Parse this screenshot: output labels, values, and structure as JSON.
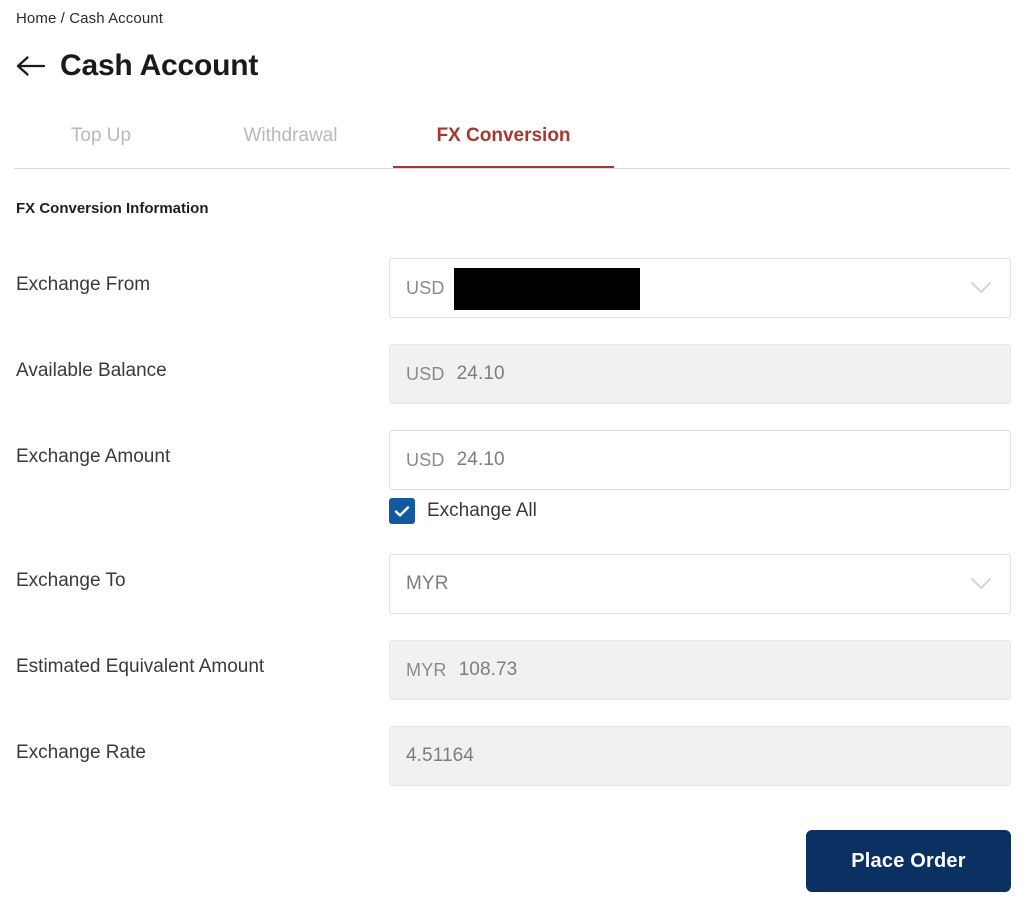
{
  "breadcrumb": {
    "text": "Home / Cash Account",
    "items": [
      "Home",
      "Cash Account"
    ],
    "separator": "/"
  },
  "header": {
    "title": "Cash Account",
    "back_icon": "arrow-left-icon"
  },
  "tabs": [
    {
      "label": "Top Up",
      "active": false
    },
    {
      "label": "Withdrawal",
      "active": false
    },
    {
      "label": "FX Conversion",
      "active": true
    }
  ],
  "section": {
    "heading": "FX Conversion Information"
  },
  "form": {
    "exchange_from": {
      "label": "Exchange From",
      "currency": "USD",
      "value": "",
      "redacted": true,
      "icon": "chevron-down-icon",
      "type": "select"
    },
    "available_balance": {
      "label": "Available Balance",
      "currency": "USD",
      "value": "24.10",
      "readonly": true
    },
    "exchange_amount": {
      "label": "Exchange Amount",
      "currency": "USD",
      "value": "24.10",
      "readonly": false
    },
    "exchange_all": {
      "label": "Exchange All",
      "checked": true,
      "icon": "checkmark-icon"
    },
    "exchange_to": {
      "label": "Exchange To",
      "currency": "",
      "value": "MYR",
      "icon": "chevron-down-icon",
      "type": "select"
    },
    "estimated_equivalent_amount": {
      "label": "Estimated Equivalent Amount",
      "currency": "MYR",
      "value": "108.73",
      "readonly": true
    },
    "exchange_rate": {
      "label": "Exchange Rate",
      "currency": "",
      "value": "4.51164",
      "readonly": true
    }
  },
  "footer": {
    "place_order_label": "Place Order"
  },
  "colors": {
    "accent_red": "#a8382f",
    "primary_navy": "#0b3163",
    "checkbox_blue": "#12599f",
    "readonly_bg": "#f1f1f1",
    "border": "#e2e2e2",
    "muted_text": "#b9b9b9"
  }
}
